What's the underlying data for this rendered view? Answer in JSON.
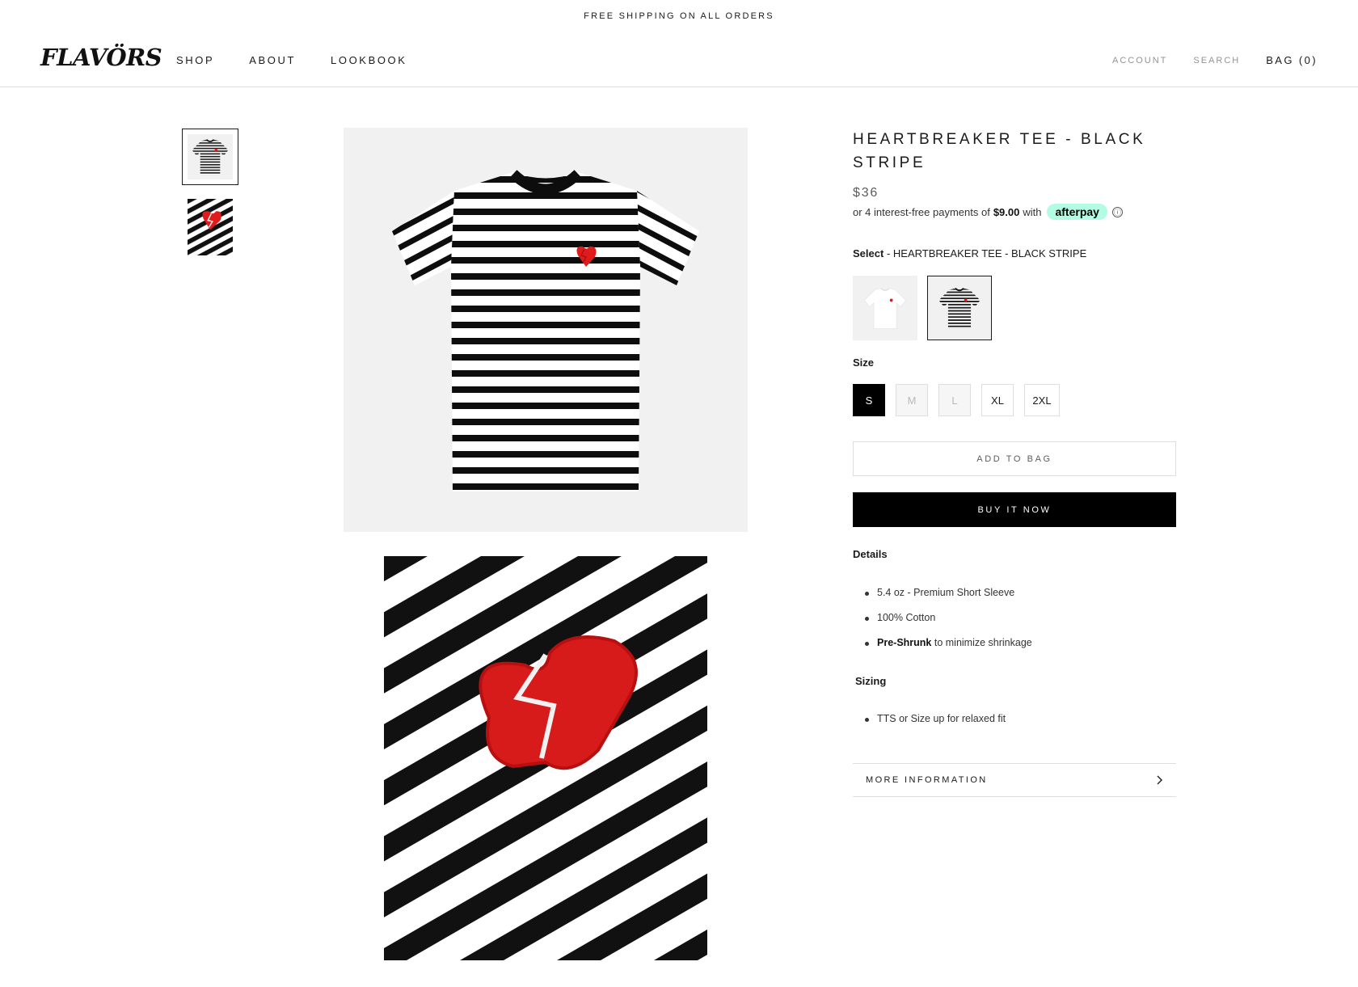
{
  "announcement": "FREE SHIPPING ON ALL ORDERS",
  "header": {
    "logo": "FLAVÖRS",
    "nav": [
      "SHOP",
      "ABOUT",
      "LOOKBOOK"
    ],
    "account": "ACCOUNT",
    "search": "SEARCH",
    "bag": "BAG (0)"
  },
  "product": {
    "title": "HEARTBREAKER TEE - BLACK STRIPE",
    "price": "$36",
    "afterpay": {
      "prefix": "or 4 interest-free payments of",
      "amount": "$9.00",
      "suffix": "with",
      "brand": "afterpay",
      "info_icon": "ⓘ"
    },
    "select_label": "Select",
    "select_value": "- HEARTBREAKER TEE - BLACK STRIPE",
    "swatches": [
      {
        "name": "white tee",
        "selected": false
      },
      {
        "name": "black stripe tee",
        "selected": true
      }
    ],
    "size_label": "Size",
    "sizes": [
      {
        "label": "S",
        "state": "selected"
      },
      {
        "label": "M",
        "state": "disabled"
      },
      {
        "label": "L",
        "state": "disabled"
      },
      {
        "label": "XL",
        "state": "available"
      },
      {
        "label": "2XL",
        "state": "available"
      }
    ],
    "add_to_bag": "ADD TO BAG",
    "buy_now": "BUY IT NOW",
    "details_heading": "Details",
    "details": [
      {
        "bold": "",
        "text": "5.4 oz - Premium Short Sleeve"
      },
      {
        "bold": "",
        "text": "100% Cotton"
      },
      {
        "bold": "Pre-Shrunk",
        "text": " to minimize shrinkage"
      }
    ],
    "sizing_heading": "Sizing",
    "sizing": [
      "TTS or Size up for relaxed fit"
    ],
    "more_info": "MORE INFORMATION"
  },
  "colors": {
    "heart": "#e01b1b",
    "afterpay_mint": "#b2fce4",
    "text": "#1c1b1b"
  },
  "icons": {
    "chevron": "chevron-right-icon",
    "info": "info-circle-icon"
  }
}
